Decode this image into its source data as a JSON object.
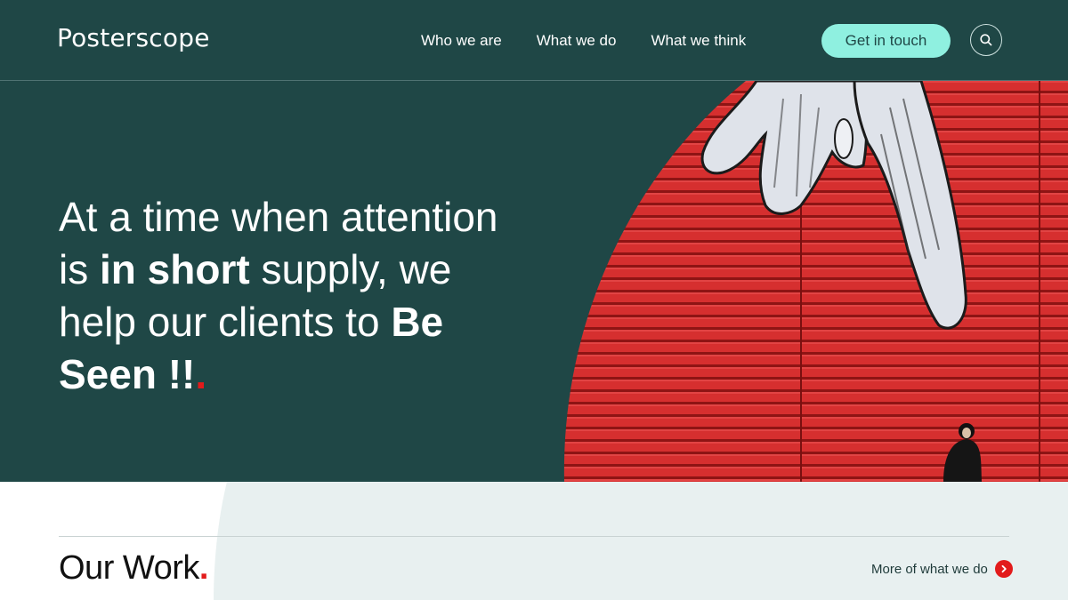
{
  "header": {
    "logo": "Posterscope",
    "nav": [
      {
        "label": "Who we are"
      },
      {
        "label": "What we do"
      },
      {
        "label": "What we think"
      }
    ],
    "cta_label": "Get in touch",
    "search_icon": "search-icon"
  },
  "hero": {
    "headline": {
      "part1": "At a time when attention is ",
      "bold1": "in short",
      "part2": " supply, we help our clients to ",
      "bold2": "Be Seen !!",
      "dot": "."
    },
    "image_icon": "pointing-hand-mural-image"
  },
  "work": {
    "title": "Our Work",
    "title_dot": ".",
    "more_label": "More of what we do",
    "more_icon": "chevron-right-icon"
  },
  "colors": {
    "brand_dark": "#1f4746",
    "accent_mint": "#8ff0e0",
    "accent_red": "#e21b1b",
    "section_tint": "#e8f0f0"
  }
}
